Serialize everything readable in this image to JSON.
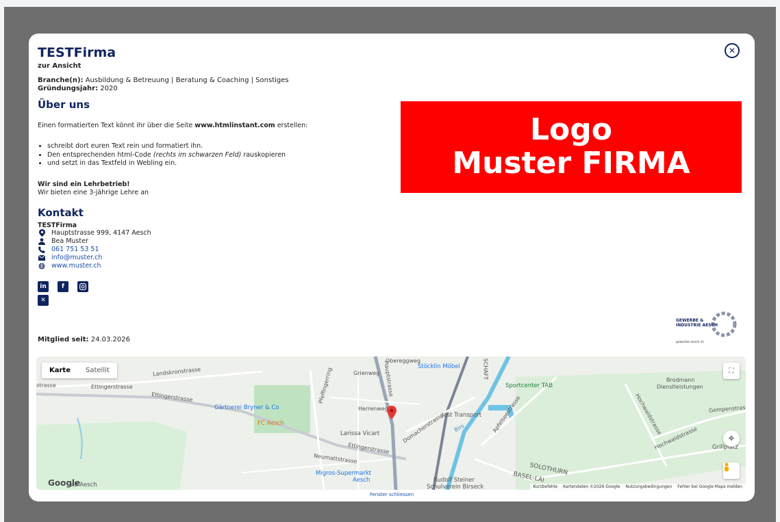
{
  "modal": {
    "close_icon": "close-circle-icon",
    "company_name": "TESTFirma",
    "subtitle": "zur Ansicht",
    "branche_label": "Branche(n):",
    "branche_value": " Ausbildung & Betreuung | Beratung & Coaching | Sonstiges",
    "gruendung_label": "Gründungsjahr:",
    "gruendung_value": " 2020",
    "about_heading": "Über uns",
    "intro_before": "Einen formatierten Text könnt ihr über die Seite ",
    "intro_link": "www.htmlinstant.com",
    "intro_after": " erstellen:",
    "bullets": [
      "schreibt dort euren Text rein und formatiert ihn.",
      "Den entsprechenden html-Code ",
      "(rechts im schwarzen Feld)",
      " rauskopieren",
      "und setzt in das Textfeld in Webling ein."
    ],
    "lehr_bold": "Wir sind ein Lehrbetrieb!",
    "lehr_text": "Wir bieten eine 3-jährige Lehre an",
    "contact_heading": "Kontakt",
    "contact_name": "TESTFirma",
    "contact_address": "Hauptstrasse 999, 4147 Aesch",
    "contact_person": "Bea Muster",
    "contact_phone": "061 751 53 51",
    "contact_email": "info@muster.ch",
    "contact_web": "www.muster.ch",
    "social": [
      "linkedin-icon",
      "facebook-icon",
      "instagram-icon",
      "x-icon"
    ],
    "member_label": "Mitglied seit:",
    "member_value": " 24.03.2026",
    "logo_line1": "Logo",
    "logo_line2": "Muster FIRMA",
    "gia_line1": "GEWERBE &",
    "gia_line2": "INDUSTRIE AESCH",
    "gia_line3": "gewerbe-aesch.ch",
    "close_window": "Fenster schliessen"
  },
  "map": {
    "tab_map": "Karte",
    "tab_satellite": "Satellit",
    "labels": {
      "landskron": "Landskronstrasse",
      "ettinger1": "Ettingerstrasse",
      "ettinger2": "Ettingerstrasse",
      "ettinger3": "Ettingerstrasse",
      "pfeffinger": "Pfeffingerring",
      "grienweg": "Grienweg",
      "obereggweg": "Obereggweg",
      "herrenweg": "Herrenweg",
      "hauptstrasse": "Hauptstrasse",
      "domacher": "Domacherstrasse",
      "apfelsee": "Apfelseestrasse",
      "hochwald1": "Hochwaldstrasse",
      "hochwald2": "Hochwaldstrasse",
      "gempen": "Gempenstrasse",
      "neumatt": "Neumattstrasse",
      "solothurn": "SOLOTHURN",
      "basel": "BASEL-LAI",
      "brodmann": "Brodmann",
      "dienst": "Dienstleistungen",
      "birs": "Birs",
      "schaft": "SCHAFT",
      "strasse": "strasse"
    },
    "pois": {
      "stoecklin": "Stöcklin Möbel",
      "sportcenter": "Sportcenter TAB",
      "gaertnerei": "Gärtnerei Bryner & Co",
      "fcaesch": "FC Aesch",
      "larissa": "Larissa Vicart",
      "transport": "Jost Transport",
      "migros1": "Migros-Supermarkt",
      "migros2": "Aesch",
      "rudolf1": "Rudolf Steiner",
      "rudolf2": "Schulverein Birseck",
      "grillplatz": "Grillplatz",
      "bab": "ab Aesch"
    },
    "google": "Google",
    "footer": {
      "shortcuts": "Kurzbefehle",
      "mapdata": "Kartendaten ©2026 Google",
      "terms": "Nutzungsbedingungen",
      "report": "Fehler bei Google Maps melden"
    }
  }
}
